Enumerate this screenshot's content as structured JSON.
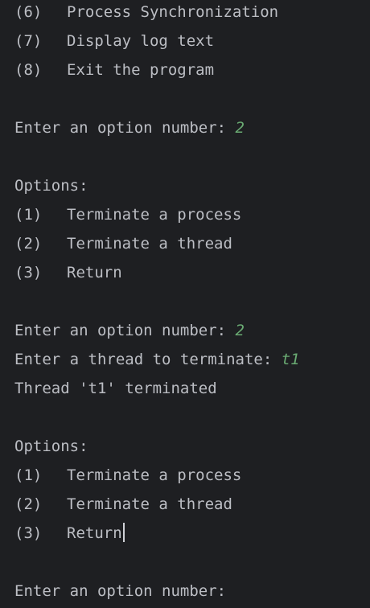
{
  "console": {
    "menu_top": [
      {
        "num": "(6)",
        "label": "Process Synchronization"
      },
      {
        "num": "(7)",
        "label": "Display log text"
      },
      {
        "num": "(8)",
        "label": "Exit the program"
      }
    ],
    "prompt_1": "Enter an option number: ",
    "input_1": "2",
    "options_header_1": "Options:",
    "options_1": [
      {
        "num": "(1)",
        "label": "Terminate a process"
      },
      {
        "num": "(2)",
        "label": "Terminate a thread"
      },
      {
        "num": "(3)",
        "label": "Return"
      }
    ],
    "prompt_2": "Enter an option number: ",
    "input_2": "2",
    "prompt_thread": "Enter a thread to terminate: ",
    "input_thread": "t1",
    "result": "Thread 't1' terminated",
    "options_header_2": "Options:",
    "options_2": [
      {
        "num": "(1)",
        "label": "Terminate a process"
      },
      {
        "num": "(2)",
        "label": "Terminate a thread"
      },
      {
        "num": "(3)",
        "label": "Return"
      }
    ],
    "prompt_3": "Enter an option number: "
  },
  "colors": {
    "background": "#1e1f22",
    "text": "#bcbec4",
    "user_input": "#6aab73"
  }
}
